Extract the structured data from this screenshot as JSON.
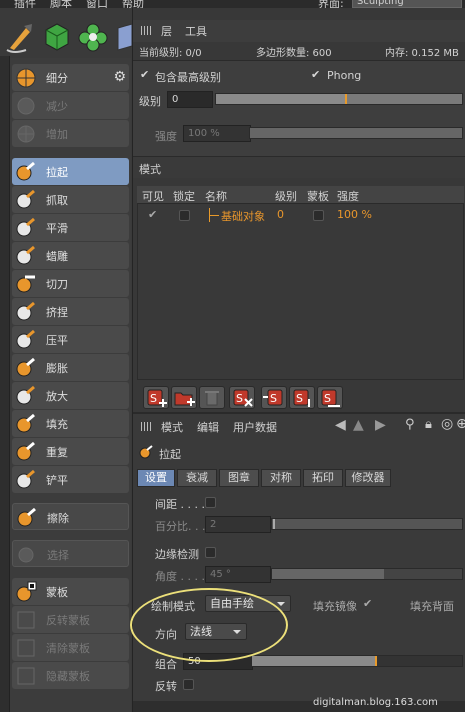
{
  "menubar": {
    "items": [
      "插件",
      "脚本",
      "窗口",
      "帮助"
    ],
    "layout_label": "界面:",
    "layout_value": "Sculpting"
  },
  "toptools": [
    {
      "icon": "sculpt-brush-icon"
    },
    {
      "icon": "green-cube-icon"
    },
    {
      "icon": "flower-icon"
    },
    {
      "icon": "box-icon"
    }
  ],
  "palette": {
    "items": [
      {
        "label": "细分",
        "icon": "subdivide-icon",
        "state": "normal"
      },
      {
        "label": "减少",
        "icon": "decrease-icon",
        "state": "disabled"
      },
      {
        "label": "增加",
        "icon": "increase-icon",
        "state": "disabled"
      },
      {
        "label": "拉起",
        "icon": "pull-brush-icon",
        "state": "selected"
      },
      {
        "label": "抓取",
        "icon": "grab-brush-icon",
        "state": "normal"
      },
      {
        "label": "平滑",
        "icon": "smooth-brush-icon",
        "state": "normal"
      },
      {
        "label": "蜡雕",
        "icon": "wax-brush-icon",
        "state": "normal"
      },
      {
        "label": "切刀",
        "icon": "knife-brush-icon",
        "state": "normal"
      },
      {
        "label": "挤捏",
        "icon": "pinch-brush-icon",
        "state": "normal"
      },
      {
        "label": "压平",
        "icon": "flatten-brush-icon",
        "state": "normal"
      },
      {
        "label": "膨胀",
        "icon": "inflate-brush-icon",
        "state": "normal"
      },
      {
        "label": "放大",
        "icon": "amplify-brush-icon",
        "state": "normal"
      },
      {
        "label": "填充",
        "icon": "fill-brush-icon",
        "state": "normal"
      },
      {
        "label": "重复",
        "icon": "repeat-brush-icon",
        "state": "normal"
      },
      {
        "label": "铲平",
        "icon": "scrape-brush-icon",
        "state": "normal"
      },
      {
        "label": "擦除",
        "icon": "erase-brush-icon",
        "state": "group"
      },
      {
        "label": "选择",
        "icon": "select-brush-icon",
        "state": "disabled"
      },
      {
        "label": "蒙板",
        "icon": "mask-brush-icon",
        "state": "normal"
      },
      {
        "label": "反转蒙板",
        "icon": "invert-mask-icon",
        "state": "disabled"
      },
      {
        "label": "清除蒙板",
        "icon": "clear-mask-icon",
        "state": "disabled"
      },
      {
        "label": "隐藏蒙板",
        "icon": "hide-mask-icon",
        "state": "disabled"
      }
    ]
  },
  "layers_panel": {
    "menu": [
      "层",
      "工具"
    ],
    "current_level_label": "当前级别: 0/0",
    "poly_count_label": "多边形数量: 600",
    "memory_label": "内存: 0.152 MB",
    "include_highest_label": "包含最高级别",
    "include_highest_checked": true,
    "phong_label": "Phong",
    "phong_checked": true,
    "level_label": "级别",
    "level_value": "0",
    "level_slider_fraction": 0.0,
    "strength_label": "强度",
    "strength_value": "100 %",
    "mode_label": "模式",
    "columns": [
      "可见",
      "锁定",
      "名称",
      "级别",
      "蒙板",
      "强度"
    ],
    "rows": [
      {
        "visible": true,
        "locked": false,
        "name": "基础对象",
        "level": "0",
        "mask": false,
        "strength": "100 %"
      }
    ],
    "buttons": [
      "add-layer-icon",
      "add-folder-icon",
      "delete-layer-icon",
      "clear-layer-icon",
      "merge-layer-icon",
      "bake-layer-icon",
      "export-layer-icon"
    ]
  },
  "attr_panel": {
    "menu": [
      "模式",
      "编辑",
      "用户数据"
    ],
    "tool_name": "拉起",
    "tabs": [
      "设置",
      "衰减",
      "图章",
      "对称",
      "拓印",
      "修改器"
    ],
    "active_tab": "设置",
    "spacing_label": "间距 . . . .",
    "percent_label": "百分比. . .",
    "percent_value": "2",
    "edge_detect_label": "边缘检测",
    "angle_label": "角度 . . . .",
    "angle_value": "45 °",
    "draw_mode_label": "绘制模式",
    "draw_mode_value": "自由手绘",
    "fill_mirror_label": "填充镜像",
    "fill_mirror_checked": true,
    "fill_back_label": "填充背面",
    "direction_label": "方向",
    "direction_value": "法线",
    "group_label": "组合",
    "group_value": "50",
    "invert_label": "反转",
    "watermark": "digitalman.blog.163.com"
  }
}
